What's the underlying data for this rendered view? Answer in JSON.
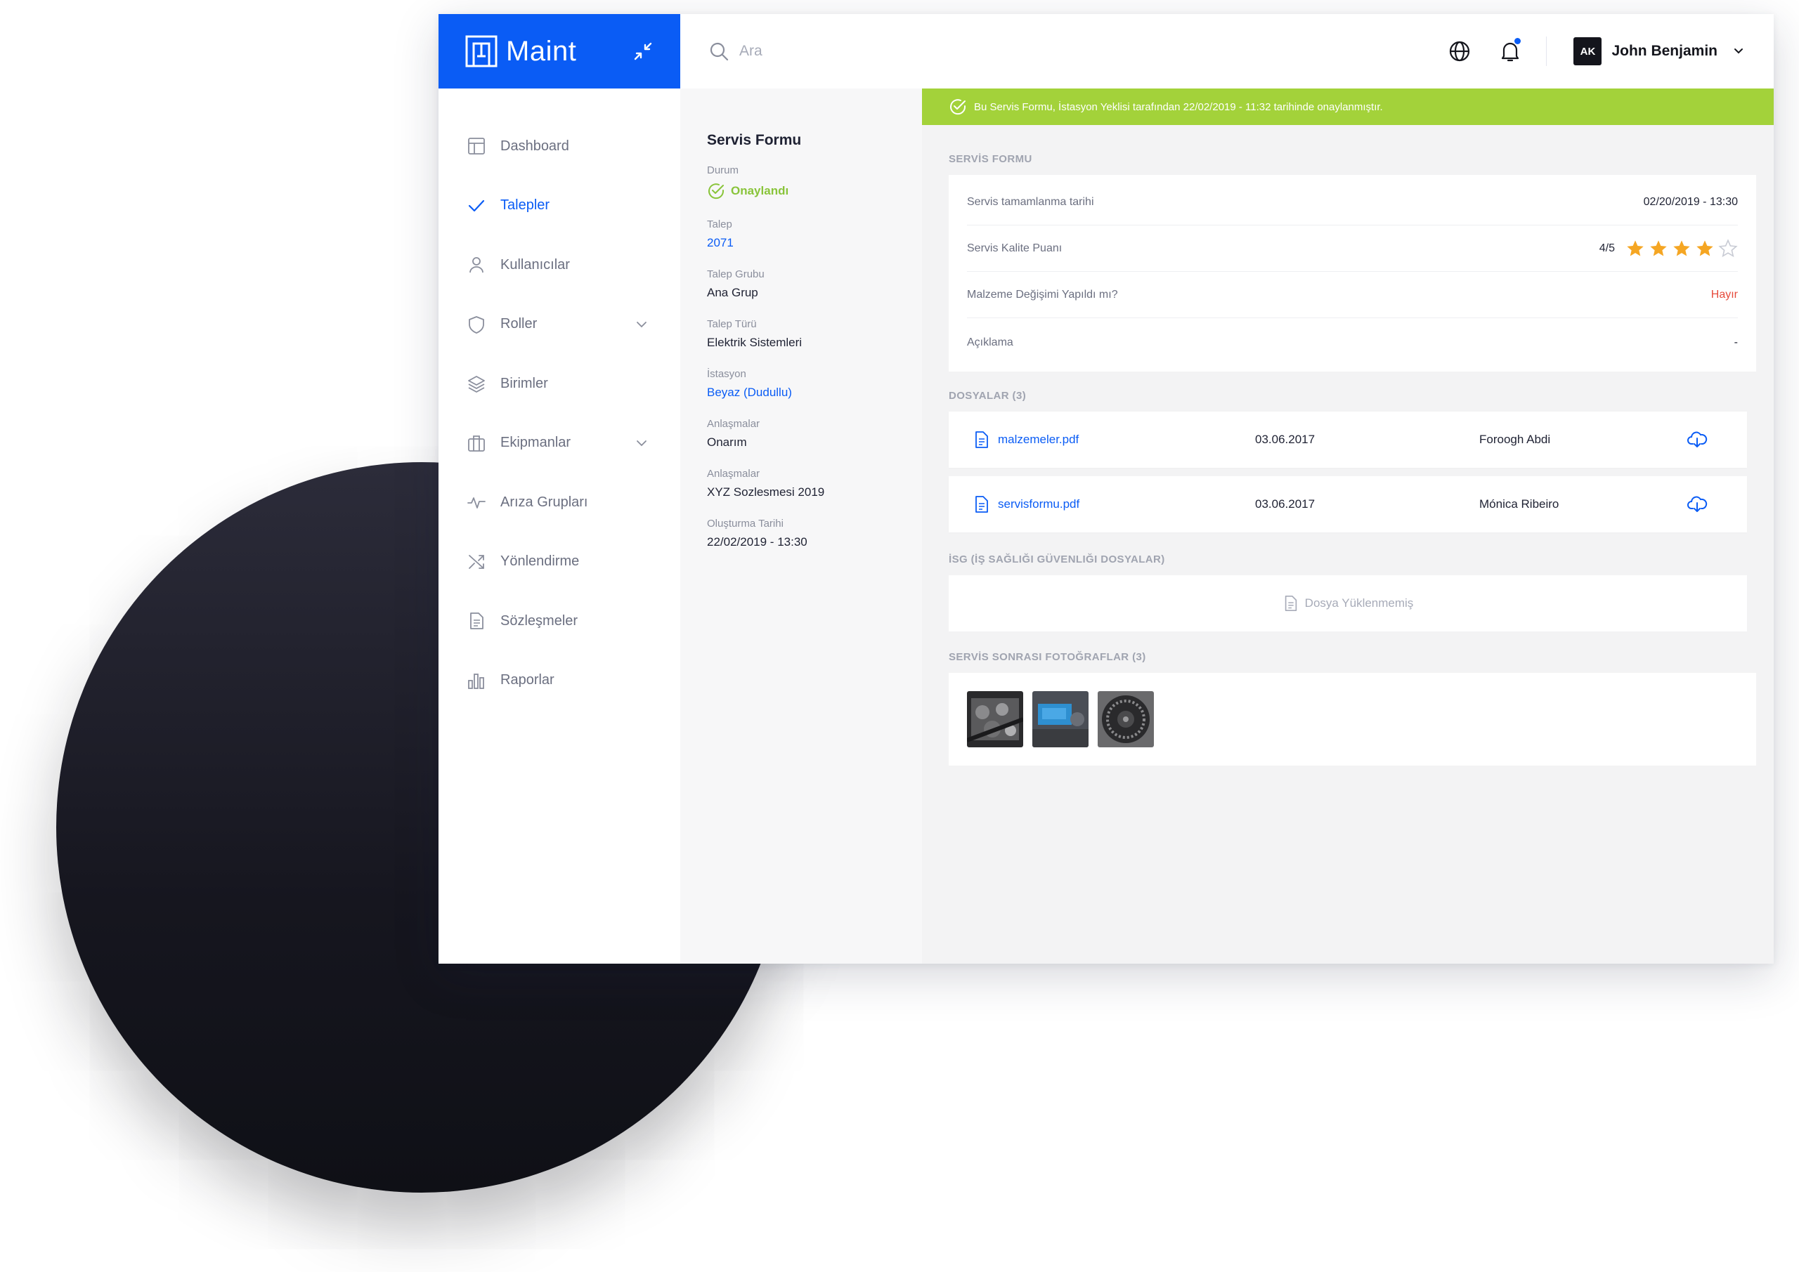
{
  "app": {
    "name": "Maint",
    "brand_color": "#0a5cf5"
  },
  "header": {
    "search_placeholder": "Ara",
    "user": {
      "initials": "AK",
      "name": "John Benjamin"
    }
  },
  "sidebar": {
    "items": [
      {
        "label": "Dashboard",
        "icon": "layout-icon"
      },
      {
        "label": "Talepler",
        "icon": "check-icon",
        "active": true
      },
      {
        "label": "Kullanıcılar",
        "icon": "user-icon"
      },
      {
        "label": "Roller",
        "icon": "shield-icon",
        "expandable": true
      },
      {
        "label": "Birimler",
        "icon": "layers-icon"
      },
      {
        "label": "Ekipmanlar",
        "icon": "briefcase-icon",
        "expandable": true
      },
      {
        "label": "Arıza Grupları",
        "icon": "activity-icon"
      },
      {
        "label": "Yönlendirme",
        "icon": "shuffle-icon"
      },
      {
        "label": "Sözleşmeler",
        "icon": "document-icon"
      },
      {
        "label": "Raporlar",
        "icon": "bar-chart-icon"
      }
    ]
  },
  "details": {
    "title": "Servis Formu",
    "status_label": "Durum",
    "status_value": "Onaylandı",
    "fields": [
      {
        "label": "Talep",
        "value": "2071",
        "link": true
      },
      {
        "label": "Talep Grubu",
        "value": "Ana Grup"
      },
      {
        "label": "Talep Türü",
        "value": "Elektrik Sistemleri"
      },
      {
        "label": "İstasyon",
        "value": "Beyaz (Dudullu)",
        "link": true
      },
      {
        "label": "Anlaşmalar",
        "value": "Onarım"
      },
      {
        "label": "Anlaşmalar",
        "value": "XYZ Sozlesmesi 2019"
      },
      {
        "label": "Oluşturma Tarihi",
        "value": "22/02/2019 - 13:30"
      }
    ]
  },
  "banner": {
    "text": "Bu Servis Formu, İstasyon Yeklisi tarafından 22/02/2019 - 11:32 tarihinde onaylanmıştır.",
    "color": "#a3d23a"
  },
  "service_form": {
    "section_title": "SERVİS FORMU",
    "rows": [
      {
        "label": "Servis tamamlanma tarihi",
        "value": "02/20/2019 - 13:30"
      },
      {
        "label": "Servis Kalite Puanı",
        "value": "4/5",
        "rating": 4,
        "rating_max": 5
      },
      {
        "label": "Malzeme Değişimi Yapıldı mı?",
        "value": "Hayır"
      },
      {
        "label": "Açıklama",
        "value": "-"
      }
    ]
  },
  "files": {
    "section_title": "DOSYALAR (3)",
    "items": [
      {
        "name": "malzemeler.pdf",
        "date": "03.06.2017",
        "owner": "Foroogh Abdi"
      },
      {
        "name": "servisformu.pdf",
        "date": "03.06.2017",
        "owner": "Mónica Ribeiro"
      }
    ]
  },
  "isg": {
    "section_title": "İSG (İŞ SAĞLIĞI GÜVENLIĞI DOSYALAR)",
    "empty_text": "Dosya Yüklenmemiş"
  },
  "photos": {
    "section_title": "SERVİS SONRASI FOTOĞRAFLAR (3)",
    "items": [
      {
        "name": "engine-photo"
      },
      {
        "name": "blue-part-photo"
      },
      {
        "name": "turbine-photo"
      }
    ]
  }
}
